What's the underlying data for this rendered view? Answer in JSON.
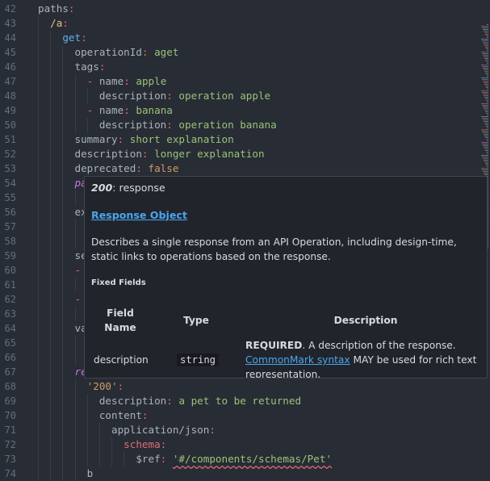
{
  "editor": {
    "lines": [
      {
        "num": "42",
        "indent": 0,
        "tokens": [
          {
            "c": "p",
            "t": "paths"
          },
          {
            "c": "k",
            "t": ":"
          }
        ]
      },
      {
        "num": "43",
        "indent": 1,
        "tokens": [
          {
            "c": "ko",
            "t": "/a"
          },
          {
            "c": "k",
            "t": ":"
          }
        ]
      },
      {
        "num": "44",
        "indent": 2,
        "tokens": [
          {
            "c": "kb",
            "t": "get"
          },
          {
            "c": "k",
            "t": ":"
          }
        ]
      },
      {
        "num": "45",
        "indent": 3,
        "tokens": [
          {
            "c": "p",
            "t": "operationId"
          },
          {
            "c": "k",
            "t": ": "
          },
          {
            "c": "s",
            "t": "aget"
          }
        ]
      },
      {
        "num": "46",
        "indent": 3,
        "tokens": [
          {
            "c": "p",
            "t": "tags"
          },
          {
            "c": "k",
            "t": ":"
          }
        ]
      },
      {
        "num": "47",
        "indent": 4,
        "tokens": [
          {
            "c": "dash",
            "t": "- "
          },
          {
            "c": "p",
            "t": "name"
          },
          {
            "c": "k",
            "t": ": "
          },
          {
            "c": "s",
            "t": "apple"
          }
        ]
      },
      {
        "num": "48",
        "indent": 5,
        "tokens": [
          {
            "c": "p",
            "t": "description"
          },
          {
            "c": "k",
            "t": ": "
          },
          {
            "c": "s",
            "t": "operation apple"
          }
        ]
      },
      {
        "num": "49",
        "indent": 4,
        "tokens": [
          {
            "c": "dash",
            "t": "- "
          },
          {
            "c": "p",
            "t": "name"
          },
          {
            "c": "k",
            "t": ": "
          },
          {
            "c": "s",
            "t": "banana"
          }
        ]
      },
      {
        "num": "50",
        "indent": 5,
        "tokens": [
          {
            "c": "p",
            "t": "description"
          },
          {
            "c": "k",
            "t": ": "
          },
          {
            "c": "s",
            "t": "operation banana"
          }
        ]
      },
      {
        "num": "51",
        "indent": 3,
        "tokens": [
          {
            "c": "p",
            "t": "summary"
          },
          {
            "c": "k",
            "t": ": "
          },
          {
            "c": "s",
            "t": "short explanation"
          }
        ]
      },
      {
        "num": "52",
        "indent": 3,
        "tokens": [
          {
            "c": "p",
            "t": "description"
          },
          {
            "c": "k",
            "t": ": "
          },
          {
            "c": "s",
            "t": "longer explanation"
          }
        ]
      },
      {
        "num": "53",
        "indent": 3,
        "tokens": [
          {
            "c": "p",
            "t": "deprecated"
          },
          {
            "c": "k",
            "t": ": "
          },
          {
            "c": "kw",
            "t": "false"
          }
        ]
      },
      {
        "num": "54",
        "indent": 3,
        "tokens": [
          {
            "c": "kp",
            "t": "pa"
          }
        ]
      },
      {
        "num": "55",
        "indent": 4,
        "tokens": []
      },
      {
        "num": "56",
        "indent": 3,
        "tokens": [
          {
            "c": "p",
            "t": "ex"
          }
        ]
      },
      {
        "num": "57",
        "indent": 4,
        "tokens": []
      },
      {
        "num": "58",
        "indent": 4,
        "tokens": []
      },
      {
        "num": "59",
        "indent": 3,
        "tokens": [
          {
            "c": "p",
            "t": "se"
          }
        ]
      },
      {
        "num": "60",
        "indent": 3,
        "tokens": [
          {
            "c": "dash",
            "t": "-"
          }
        ]
      },
      {
        "num": "61",
        "indent": 4,
        "tokens": []
      },
      {
        "num": "62",
        "indent": 3,
        "tokens": [
          {
            "c": "dash",
            "t": "-"
          }
        ]
      },
      {
        "num": "63",
        "indent": 4,
        "tokens": []
      },
      {
        "num": "64",
        "indent": 3,
        "tokens": [
          {
            "c": "p",
            "t": "va"
          }
        ]
      },
      {
        "num": "65",
        "indent": 4,
        "tokens": []
      },
      {
        "num": "66",
        "indent": 4,
        "tokens": []
      },
      {
        "num": "67",
        "indent": 3,
        "tokens": [
          {
            "c": "kp",
            "t": "re"
          }
        ]
      },
      {
        "num": "68",
        "indent": 4,
        "tokens": [
          {
            "c": "kr",
            "t": "'200'"
          },
          {
            "c": "k",
            "t": ":"
          }
        ]
      },
      {
        "num": "69",
        "indent": 5,
        "tokens": [
          {
            "c": "p",
            "t": "description"
          },
          {
            "c": "k",
            "t": ": "
          },
          {
            "c": "s",
            "t": "a pet to be returned"
          }
        ]
      },
      {
        "num": "70",
        "indent": 5,
        "tokens": [
          {
            "c": "p",
            "t": "content"
          },
          {
            "c": "k",
            "t": ":"
          }
        ]
      },
      {
        "num": "71",
        "indent": 6,
        "tokens": [
          {
            "c": "p",
            "t": "application/json"
          },
          {
            "c": "k",
            "t": ":"
          }
        ]
      },
      {
        "num": "72",
        "indent": 7,
        "tokens": [
          {
            "c": "k",
            "t": "schema"
          },
          {
            "c": "k",
            "t": ":"
          }
        ]
      },
      {
        "num": "73",
        "indent": 8,
        "tokens": [
          {
            "c": "ref",
            "t": "$ref"
          },
          {
            "c": "k",
            "t": ": "
          },
          {
            "c": "sq",
            "t": "'#/components/schemas/Pet'"
          }
        ]
      },
      {
        "num": "74",
        "indent": 4,
        "tokens": [
          {
            "c": "p",
            "t": "b"
          }
        ]
      }
    ]
  },
  "hover": {
    "status_code": "200",
    "title_suffix": ": response",
    "object_link": "Response Object",
    "description": "Describes a single response from an API Operation, including design-time, static links to operations based on the response.",
    "fixed_fields_label": "Fixed Fields",
    "table": {
      "headers": [
        "Field Name",
        "Type",
        "Description"
      ],
      "row": {
        "field": "description",
        "type": "string",
        "required": "REQUIRED",
        "desc_part1": ". A description of the response.",
        "link": "CommonMark syntax",
        "desc_part2": " MAY be used for rich text representation."
      }
    }
  },
  "colors": {
    "link": "#4aa5f0",
    "background": "#282c34",
    "popup": "#21252b"
  }
}
